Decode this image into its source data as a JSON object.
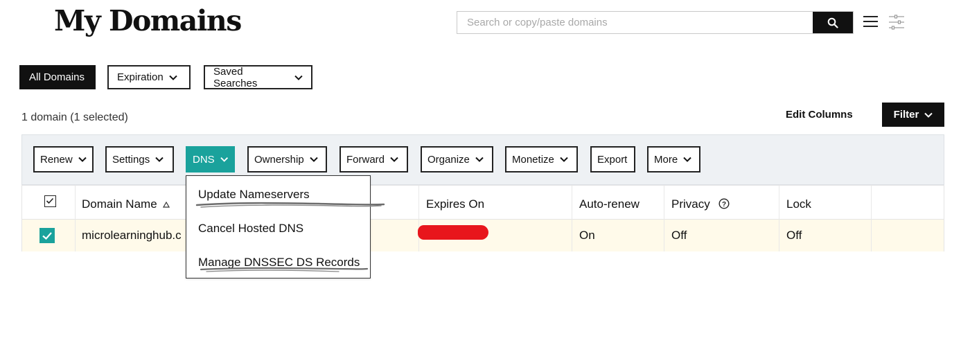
{
  "header": {
    "title": "My Domains"
  },
  "search": {
    "placeholder": "Search or copy/paste domains"
  },
  "icons": {
    "search": "search-icon",
    "menu": "hamburger-menu-icon",
    "grid": "grid-view-icon",
    "chevron": "chevron-down-icon",
    "sort": "sort-ascending-icon",
    "help": "help-circle-icon",
    "check": "check-icon"
  },
  "tabs": [
    {
      "label": "All Domains",
      "active": true
    },
    {
      "label": "Expiration",
      "active": false
    },
    {
      "label": "Saved Searches",
      "active": false
    }
  ],
  "summary": {
    "count_text": "1 domain (1 selected)"
  },
  "edit_columns": "Edit Columns",
  "filter_button": "Filter",
  "actions": [
    {
      "label": "Renew"
    },
    {
      "label": "Settings"
    },
    {
      "label": "DNS",
      "open": true
    },
    {
      "label": "Ownership"
    },
    {
      "label": "Forward"
    },
    {
      "label": "Organize"
    },
    {
      "label": "Monetize"
    },
    {
      "label": "Export"
    },
    {
      "label": "More"
    }
  ],
  "dns_menu": [
    {
      "label": "Update Nameservers"
    },
    {
      "label": "Cancel Hosted DNS"
    },
    {
      "label": "Manage DNSSEC DS Records"
    }
  ],
  "table": {
    "headers": {
      "domain_name": "Domain Name",
      "expires_on": "Expires On",
      "auto_renew": "Auto-renew",
      "privacy": "Privacy",
      "lock": "Lock"
    },
    "rows": [
      {
        "selected": true,
        "domain_name": "microlearninghub.c",
        "expires_on": "",
        "auto_renew": "On",
        "privacy": "Off",
        "lock": "Off"
      }
    ]
  },
  "colors": {
    "accent": "#1aa29c",
    "dark": "#111111",
    "selected_row": "#fffaea",
    "redaction": "#e8161c",
    "toolbar_bg": "#eef1f4"
  }
}
